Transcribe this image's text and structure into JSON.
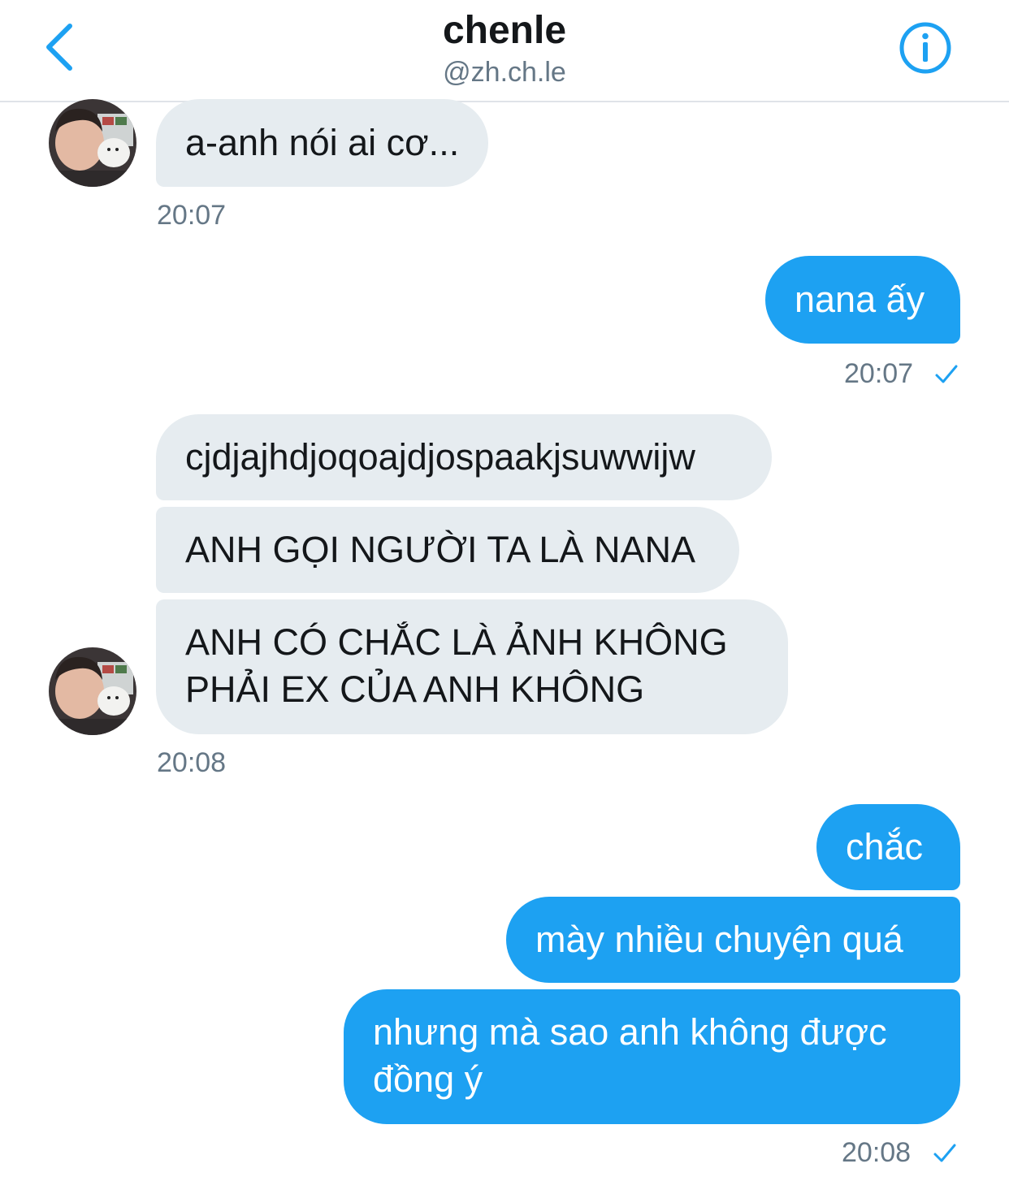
{
  "header": {
    "back_icon": "chevron-left-icon",
    "title": "chenle",
    "handle": "@zh.ch.le",
    "info_icon": "info-circle-icon",
    "accent": "#1da1f2"
  },
  "messages": [
    {
      "direction": "incoming",
      "text": "a-anh nói ai cơ..."
    },
    {
      "direction": "incoming",
      "time": "20:07"
    },
    {
      "direction": "outgoing",
      "text": "nana ấy"
    },
    {
      "direction": "outgoing",
      "time": "20:07",
      "status_icon": "check-icon"
    },
    {
      "direction": "incoming",
      "text": "cjdjajhdjoqoajdjospaakjsuwwijw"
    },
    {
      "direction": "incoming",
      "text": "ANH GỌI NGƯỜI TA LÀ NANA"
    },
    {
      "direction": "incoming",
      "text_line1": "ANH CÓ CHẮC LÀ ẢNH KHÔNG",
      "text_line2": "PHẢI EX CỦA ANH KHÔNG"
    },
    {
      "direction": "incoming",
      "time": "20:08"
    },
    {
      "direction": "outgoing",
      "text": "chắc"
    },
    {
      "direction": "outgoing",
      "text": "mày nhiều chuyện quá"
    },
    {
      "direction": "outgoing",
      "text_line1": "nhưng mà sao anh không được",
      "text_line2": "đồng ý"
    },
    {
      "direction": "outgoing",
      "time": "20:08",
      "status_icon": "check-icon"
    }
  ],
  "colors": {
    "incoming_bubble": "#e6ecf0",
    "outgoing_bubble": "#1da1f2",
    "timestamp": "#657786"
  }
}
